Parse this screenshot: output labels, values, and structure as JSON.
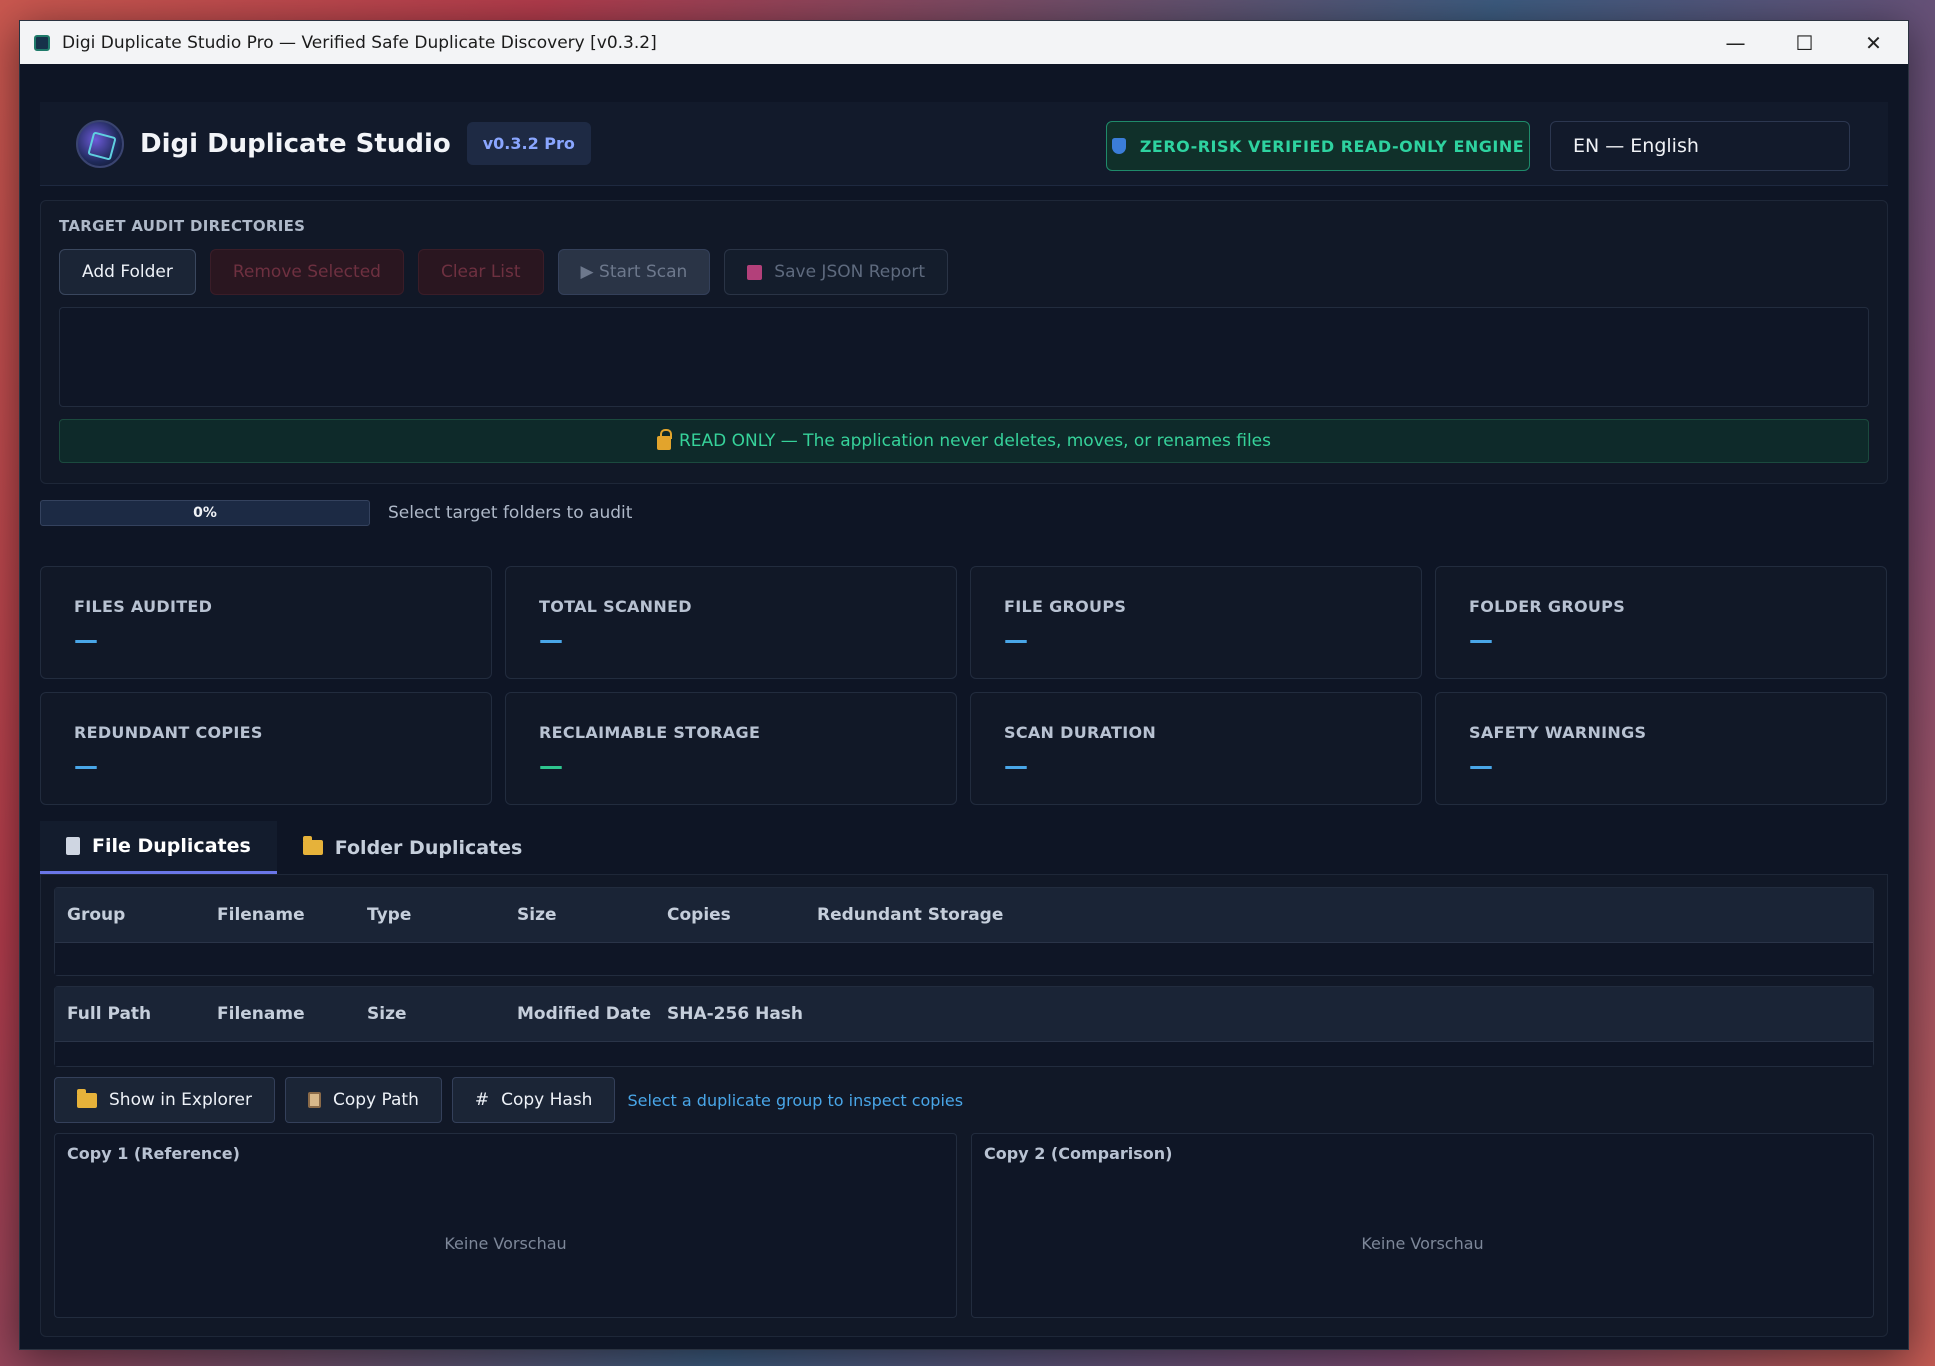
{
  "window": {
    "title": "Digi Duplicate Studio Pro — Verified Safe Duplicate Discovery [v0.3.2]",
    "minimize": "—",
    "maximize": "☐",
    "close": "✕"
  },
  "header": {
    "brand": "Digi Duplicate Studio",
    "version": "v0.3.2 Pro",
    "safe_badge": "ZERO-RISK VERIFIED READ-ONLY ENGINE",
    "language": "EN — English"
  },
  "audit": {
    "title": "TARGET AUDIT DIRECTORIES",
    "add_folder": "Add Folder",
    "remove_selected": "Remove Selected",
    "clear_list": "Clear List",
    "start_scan": "▶ Start Scan",
    "save_report": "Save JSON Report",
    "readonly_banner": "READ ONLY — The application never deletes, moves, or renames files"
  },
  "progress": {
    "percent": 0,
    "label": "0%",
    "status": "Select target folders to audit"
  },
  "stats": [
    {
      "label": "FILES AUDITED",
      "value": "—",
      "color": "#49a6e8"
    },
    {
      "label": "TOTAL SCANNED",
      "value": "—",
      "color": "#49a6e8"
    },
    {
      "label": "FILE GROUPS",
      "value": "—",
      "color": "#49a6e8"
    },
    {
      "label": "FOLDER GROUPS",
      "value": "—",
      "color": "#49a6e8"
    },
    {
      "label": "REDUNDANT COPIES",
      "value": "—",
      "color": "#49a6e8"
    },
    {
      "label": "RECLAIMABLE STORAGE",
      "value": "—",
      "color": "#2ec58e"
    },
    {
      "label": "SCAN DURATION",
      "value": "—",
      "color": "#49a6e8"
    },
    {
      "label": "SAFETY WARNINGS",
      "value": "—",
      "color": "#49a6e8"
    }
  ],
  "tabs": [
    {
      "label": "File Duplicates",
      "icon": "document-icon",
      "active": true
    },
    {
      "label": "Folder Duplicates",
      "icon": "folder-icon",
      "active": false
    }
  ],
  "groups_table": {
    "columns": [
      "Group",
      "Filename",
      "Type",
      "Size",
      "Copies",
      "Redundant Storage"
    ]
  },
  "copies_table": {
    "columns": [
      "Full Path",
      "Filename",
      "Size",
      "Modified Date",
      "SHA-256 Hash"
    ]
  },
  "actions": {
    "show_in_explorer": "Show in Explorer",
    "copy_path": "Copy Path",
    "copy_hash": "Copy Hash",
    "hint": "Select a duplicate group to inspect copies"
  },
  "previews": {
    "left_title": "Copy 1 (Reference)",
    "right_title": "Copy 2 (Comparison)",
    "empty_text": "Keine Vorschau"
  }
}
